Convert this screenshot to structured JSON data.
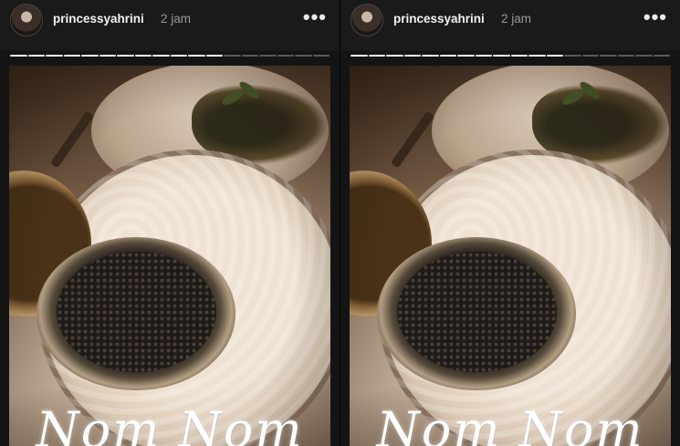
{
  "stories": [
    {
      "username": "princessyahrini",
      "time": "2 jam",
      "more_icon": "more-horizontal-icon",
      "caption": "Nom Nom",
      "progress": {
        "segments_total": 18,
        "segments_viewed": 12
      },
      "colors": {
        "viewed": "#f5f5f5",
        "unviewed": "#5a5a5a",
        "caption": "#ffffff"
      }
    },
    {
      "username": "princessyahrini",
      "time": "2 jam",
      "more_icon": "more-horizontal-icon",
      "caption": "Nom Nom",
      "progress": {
        "segments_total": 18,
        "segments_viewed": 12
      },
      "colors": {
        "viewed": "#f5f5f5",
        "unviewed": "#5a5a5a",
        "caption": "#ffffff"
      }
    }
  ]
}
